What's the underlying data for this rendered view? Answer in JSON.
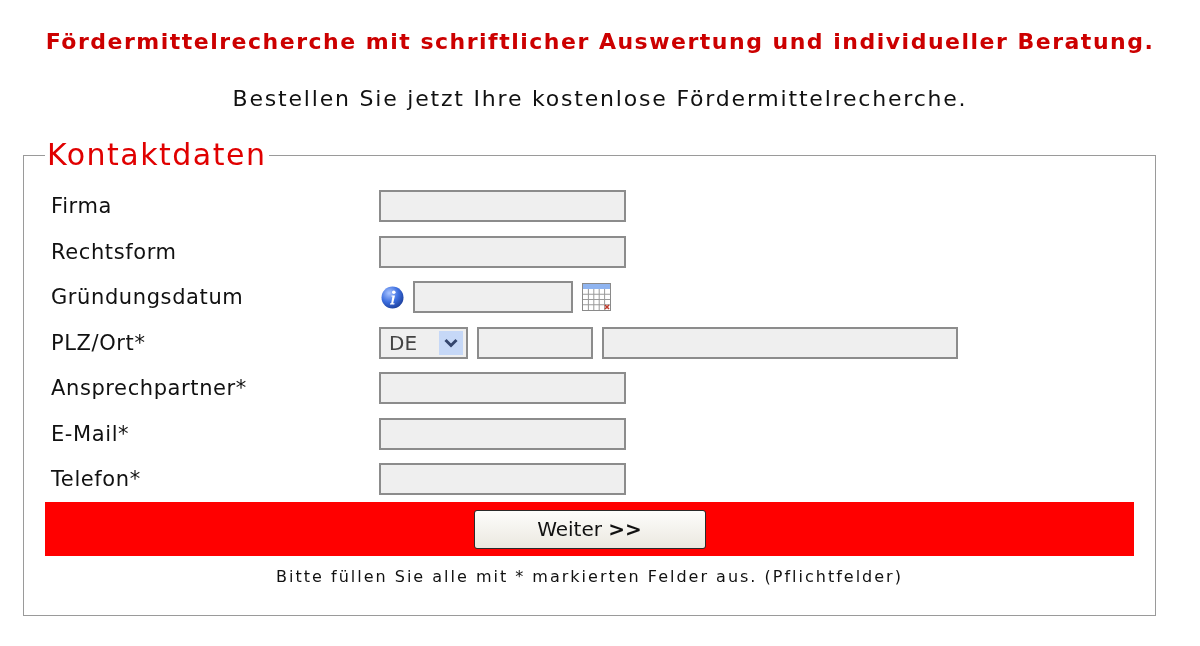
{
  "headline": "Fördermittelrecherche mit schriftlicher Auswertung und individueller Beratung.",
  "subtitle": "Bestellen Sie jetzt Ihre kostenlose Fördermittelrecherche.",
  "form": {
    "legend": "Kontaktdaten",
    "rows": [
      {
        "kind": "text",
        "label": "Firma"
      },
      {
        "kind": "text",
        "label": "Rechtsform"
      },
      {
        "kind": "date",
        "label": "Gründungsdatum"
      },
      {
        "kind": "location",
        "label": "PLZ/Ort*",
        "country": "DE"
      },
      {
        "kind": "text",
        "label": "Ansprechpartner*"
      },
      {
        "kind": "text",
        "label": "E-Mail*"
      },
      {
        "kind": "text",
        "label": "Telefon*"
      }
    ],
    "submit": "Weiter **>>**",
    "note": "Bitte füllen Sie alle mit * markierten Felder aus. (Pflichtfelder)"
  }
}
